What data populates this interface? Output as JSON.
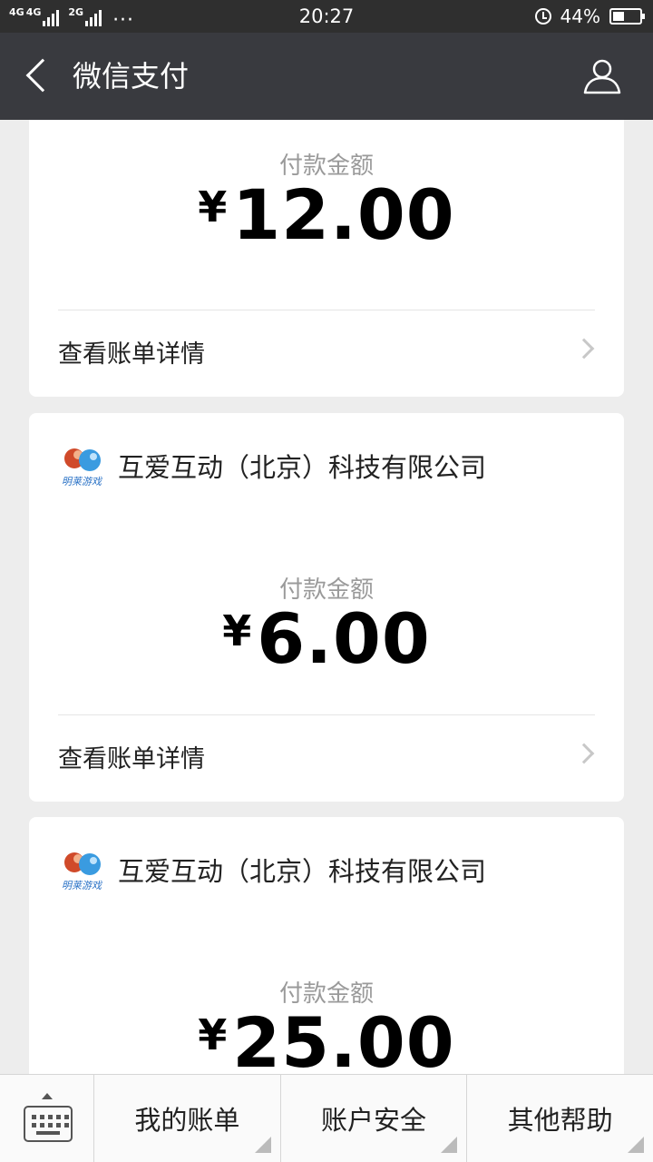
{
  "status_bar": {
    "network_1": "4G",
    "network_2": "4G",
    "network_3": "2G",
    "time": "20:27",
    "battery_percent": "44%",
    "battery_level": 0.44
  },
  "nav": {
    "title": "微信支付"
  },
  "cards": [
    {
      "amount_label": "付款金额",
      "currency": "¥",
      "amount": "12.00",
      "detail_label": "查看账单详情"
    },
    {
      "merchant": "互爱互动（北京）科技有限公司",
      "amount_label": "付款金额",
      "currency": "¥",
      "amount": "6.00",
      "detail_label": "查看账单详情"
    },
    {
      "merchant": "互爱互动（北京）科技有限公司",
      "amount_label": "付款金额",
      "currency": "¥",
      "amount": "25.00"
    }
  ],
  "logo_text": "明莱游戏",
  "bottom_menu": {
    "item_1": "我的账单",
    "item_2": "账户安全",
    "item_3": "其他帮助"
  },
  "icons": [
    "back-icon",
    "profile-icon",
    "alarm-icon",
    "battery-icon",
    "merchant-logo-icon",
    "chevron-right-icon",
    "keyboard-icon"
  ]
}
